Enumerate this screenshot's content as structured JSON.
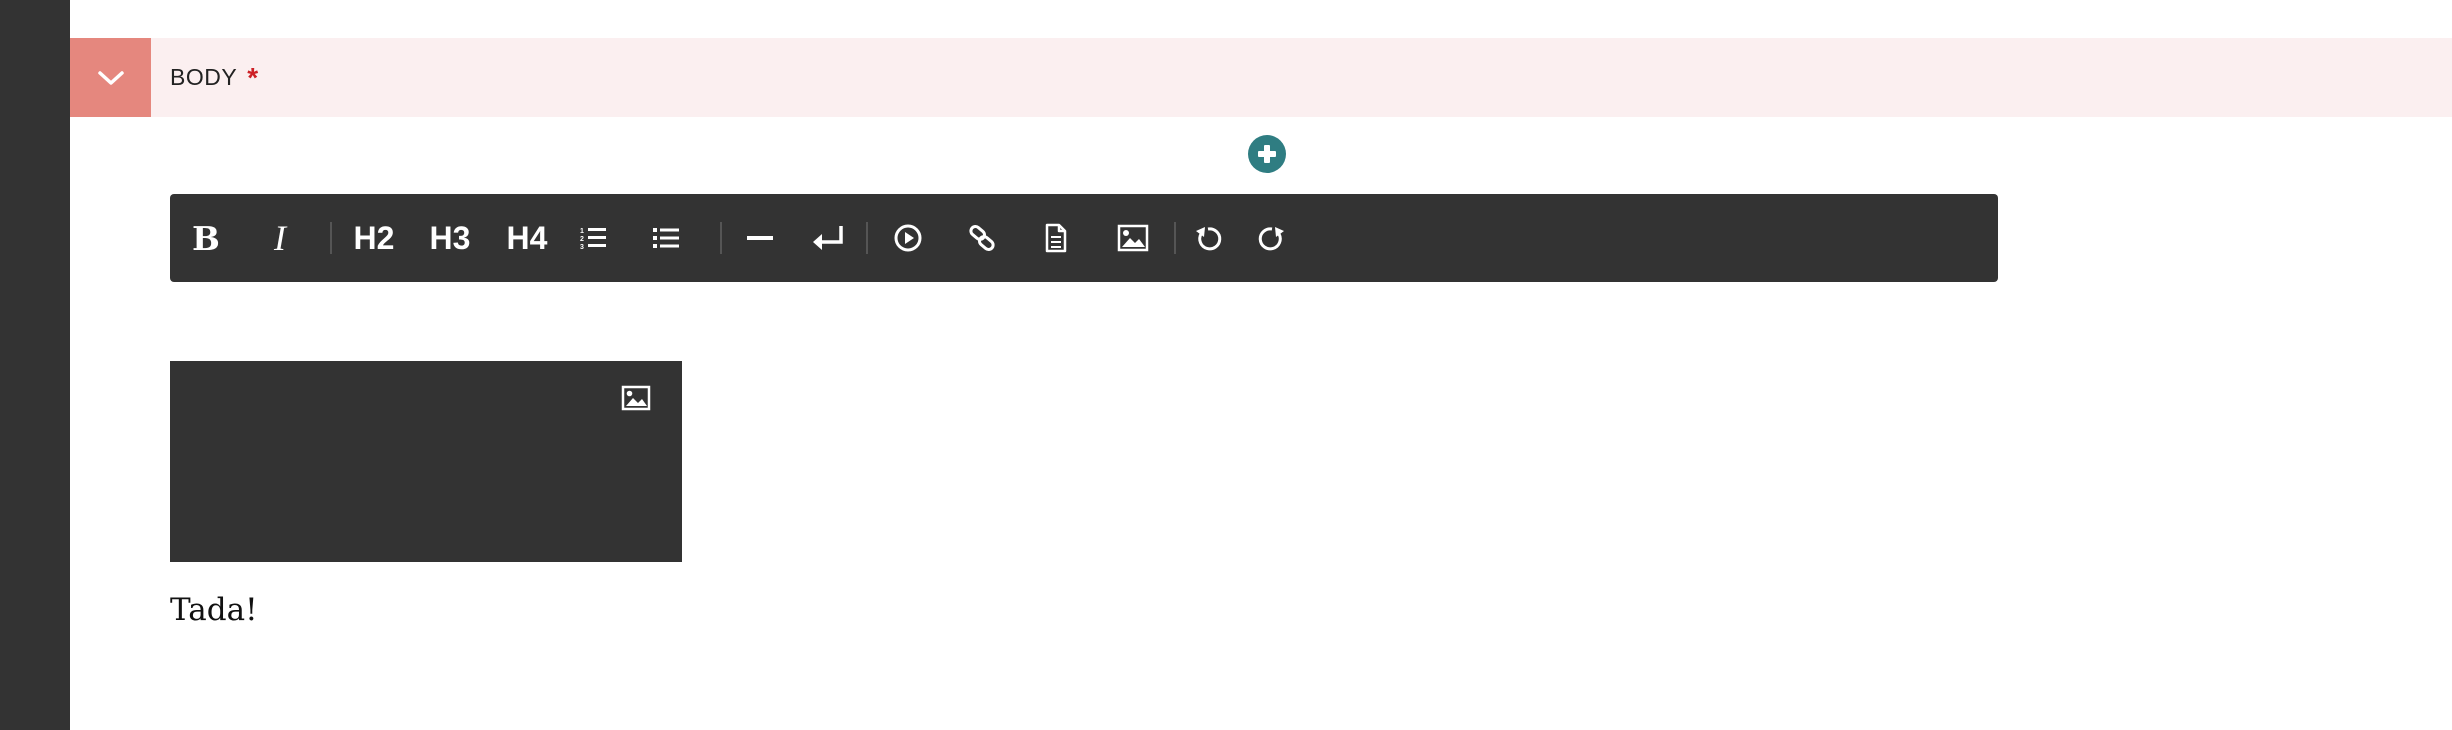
{
  "field": {
    "label": "BODY",
    "required_marker": "*"
  },
  "toolbar": {
    "bold_label": "B",
    "italic_label": "I",
    "h2_label": "H2",
    "h3_label": "H3",
    "h4_label": "H4",
    "icons": [
      "ordered-list-icon",
      "unordered-list-icon",
      "horizontal-rule-icon",
      "line-break-icon",
      "embed-video-icon",
      "link-icon",
      "document-icon",
      "image-icon",
      "undo-icon",
      "redo-icon"
    ]
  },
  "content": {
    "paragraph": "Tada!"
  },
  "colors": {
    "sidebar": "#333333",
    "header_background": "#fbeff0",
    "collapse_button": "#e5877e",
    "required_star": "#cd2026",
    "add_button": "#2f7d82",
    "toolbar_background": "#333333"
  }
}
